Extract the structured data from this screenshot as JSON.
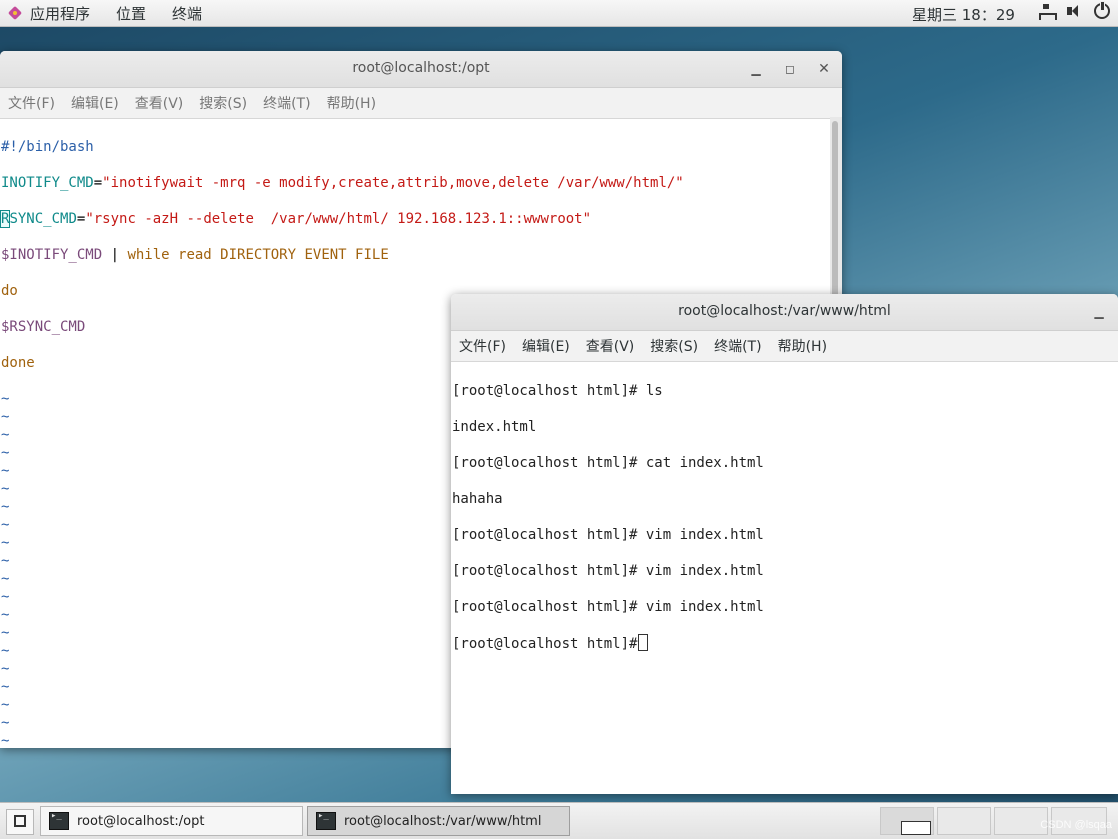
{
  "top_panel": {
    "apps_label": "应用程序",
    "places_label": "位置",
    "terminal_label": "终端",
    "clock": "星期三 18：29"
  },
  "window_opt": {
    "title": "root@localhost:/opt",
    "menu": [
      "文件(F)",
      "编辑(E)",
      "查看(V)",
      "搜索(S)",
      "终端(T)",
      "帮助(H)"
    ],
    "script": {
      "shebang": "#!/bin/bash",
      "line2_var": "INOTIFY_CMD",
      "line2_eq": "=",
      "line2_str": "\"inotifywait -mrq -e modify,create,attrib,move,delete /var/www/html/\"",
      "line3_cursor": "R",
      "line3_var": "SYNC_CMD",
      "line3_eq": "=",
      "line3_str": "\"rsync -azH --delete  /var/www/html/ 192.168.123.1::wwwroot\"",
      "line4_ref": "$INOTIFY_CMD",
      "line4_pipe": " | ",
      "line4_kw": "while read DIRECTORY EVENT FILE",
      "line5": "do",
      "line6": "$RSYNC_CMD",
      "line7": "done",
      "tilde": "~"
    }
  },
  "window_html": {
    "title": "root@localhost:/var/www/html",
    "menu": [
      "文件(F)",
      "编辑(E)",
      "查看(V)",
      "搜索(S)",
      "终端(T)",
      "帮助(H)"
    ],
    "lines": [
      "[root@localhost html]# ls",
      "index.html",
      "[root@localhost html]# cat index.html",
      "hahaha",
      "[root@localhost html]# vim index.html",
      "[root@localhost html]# vim index.html",
      "[root@localhost html]# vim index.html",
      "[root@localhost html]#"
    ]
  },
  "taskbar": {
    "task1": "root@localhost:/opt",
    "task2": "root@localhost:/var/www/html",
    "watermark": "CSDN @lsqaa"
  }
}
